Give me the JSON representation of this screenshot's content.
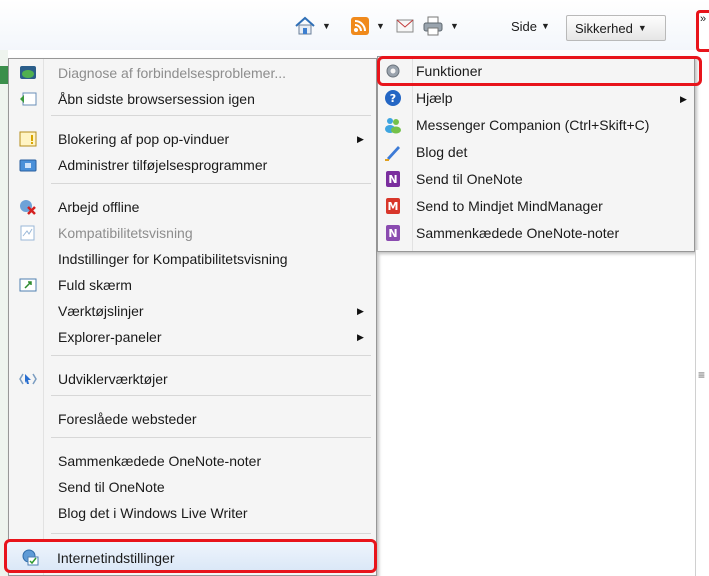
{
  "toolbar": {
    "side_label": "Side",
    "sikkerhed_label": "Sikkerhed",
    "overflow_label": "»"
  },
  "menu": {
    "items": [
      {
        "label": "Diagnose af forbindelsesproblemer...",
        "disabled": true
      },
      {
        "label": "Åbn sidste browsersession igen"
      },
      {
        "label": "Blokering af pop op-vinduer",
        "submenu": true
      },
      {
        "label": "Administrer tilføjelsesprogrammer"
      },
      {
        "label": "Arbejd offline"
      },
      {
        "label": "Kompatibilitetsvisning",
        "disabled": true
      },
      {
        "label": "Indstillinger for Kompatibilitetsvisning"
      },
      {
        "label": "Fuld skærm"
      },
      {
        "label": "Værktøjslinjer",
        "submenu": true
      },
      {
        "label": "Explorer-paneler",
        "submenu": true
      },
      {
        "label": "Udviklerværktøjer"
      },
      {
        "label": "Foreslåede websteder"
      },
      {
        "label": "Sammenkædede OneNote-noter"
      },
      {
        "label": "Send til OneNote"
      },
      {
        "label": "Blog det i Windows Live Writer"
      },
      {
        "label": "Internetindstillinger"
      }
    ]
  },
  "submenu": {
    "items": [
      {
        "label": "Funktioner"
      },
      {
        "label": "Hjælp"
      },
      {
        "label": "Messenger Companion (Ctrl+Skift+C)"
      },
      {
        "label": "Blog det"
      },
      {
        "label": "Send til OneNote"
      },
      {
        "label": "Send to Mindjet MindManager"
      },
      {
        "label": "Sammenkædede OneNote-noter"
      }
    ]
  },
  "colors": {
    "highlight": "#e8141b",
    "menu_bg": "#f5f5f5"
  }
}
